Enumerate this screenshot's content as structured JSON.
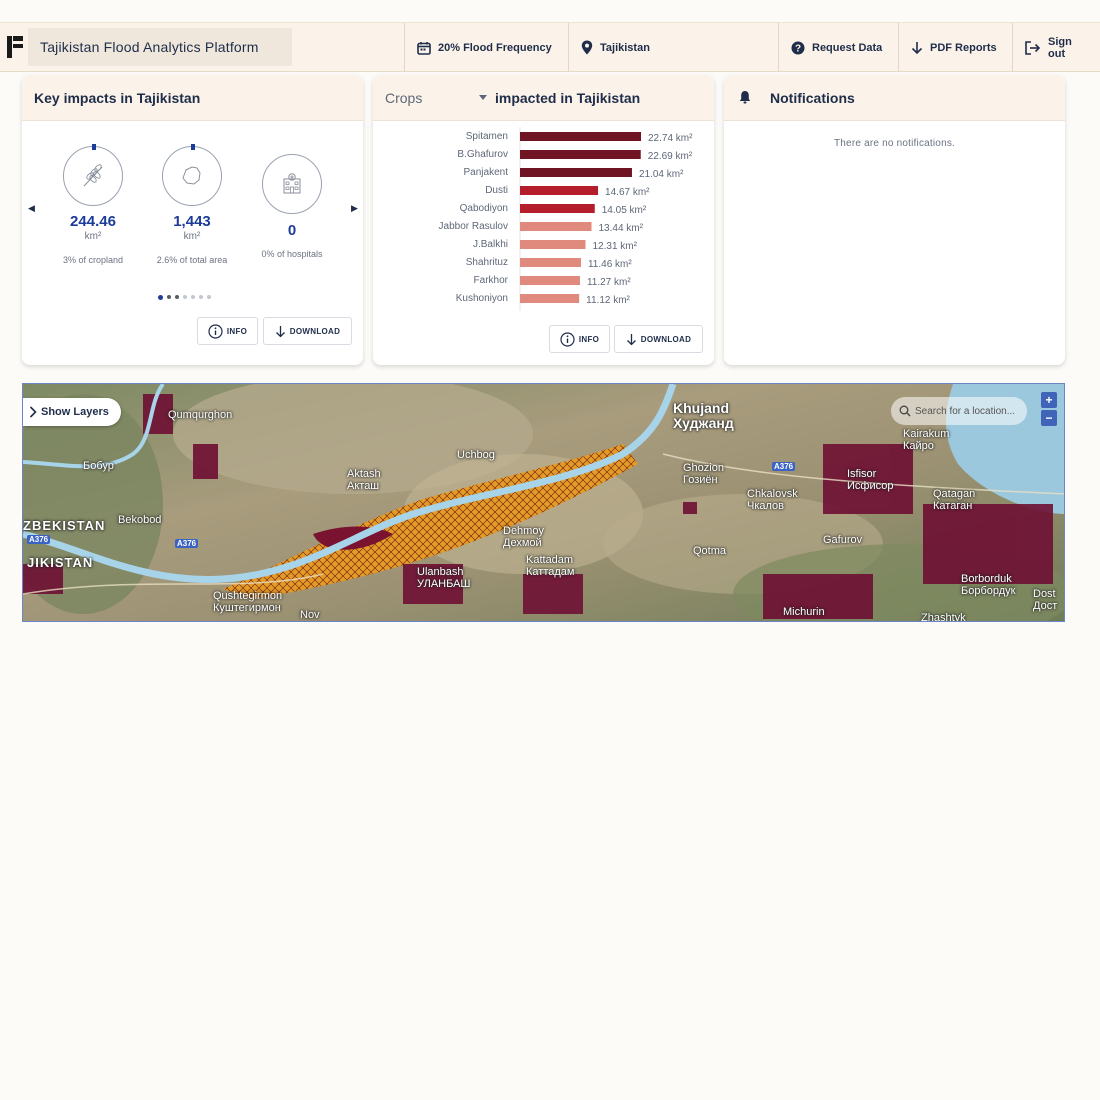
{
  "header": {
    "app_title": "Tajikistan Flood Analytics Platform",
    "nav": [
      {
        "label": "20% Flood Frequency",
        "icon": "calendar-icon"
      },
      {
        "label": "Tajikistan",
        "icon": "map-pin-icon"
      },
      {
        "label": "Request Data",
        "icon": "question-icon"
      },
      {
        "label": "PDF Reports",
        "icon": "download-arrow-icon"
      },
      {
        "label": "Sign out",
        "icon": "sign-out-icon"
      }
    ]
  },
  "impacts_card": {
    "title": "Key impacts in Tajikistan",
    "stats": [
      {
        "value": "244.46",
        "unit": "km²",
        "description": "3% of cropland",
        "icon": "wheat-icon"
      },
      {
        "value": "1,443",
        "unit": "km²",
        "description": "2.6% of total area",
        "icon": "area-outline-icon"
      },
      {
        "value": "0",
        "unit": "",
        "description": "0% of hospitals",
        "icon": "hospital-icon"
      }
    ],
    "info_label": "INFO",
    "download_label": "DOWNLOAD",
    "active_page": 1,
    "page_count": 7
  },
  "crops_card": {
    "dropdown_value": "Crops",
    "title_suffix": "impacted in Tajikistan",
    "info_label": "INFO",
    "download_label": "DOWNLOAD"
  },
  "chart_data": {
    "type": "bar",
    "orientation": "horizontal",
    "categories": [
      "Spitamen",
      "B.Ghafurov",
      "Panjakent",
      "Dusti",
      "Qabodiyon",
      "Jabbor Rasulov",
      "J.Balkhi",
      "Shahrituz",
      "Farkhor",
      "Kushoniyon"
    ],
    "values": [
      22.74,
      22.69,
      21.04,
      14.67,
      14.05,
      13.44,
      12.31,
      11.46,
      11.27,
      11.12
    ],
    "labels": [
      "22.74 km²",
      "22.69 km²",
      "21.04 km²",
      "14.67 km²",
      "14.05 km²",
      "13.44 km²",
      "12.31 km²",
      "11.46 km²",
      "11.27 km²",
      "11.12 km²"
    ],
    "unit": "km²",
    "colors": [
      "#6e1423",
      "#6e1423",
      "#6e1423",
      "#b41e2c",
      "#b41e2c",
      "#e08a7d",
      "#e08a7d",
      "#e08a7d",
      "#e08a7d",
      "#e08a7d"
    ],
    "title": "",
    "xlabel": "",
    "ylabel": ""
  },
  "notifications_card": {
    "title": "Notifications",
    "empty_text": "There are no notifications."
  },
  "map": {
    "show_layers_label": "Show Layers",
    "search_placeholder": "Search for a location...",
    "zoom_in": "+",
    "zoom_out": "−",
    "labels": [
      {
        "text": "Khujand",
        "sub": "Худжанд",
        "kind": "big"
      },
      {
        "text": "Ghozion",
        "sub": "Гозиён"
      },
      {
        "text": "Chkalovsk",
        "sub": "Чкалов"
      },
      {
        "text": "Isfisor",
        "sub": "Исфисор"
      },
      {
        "text": "Kairakum",
        "sub": "Кайро"
      },
      {
        "text": "Qatagan",
        "sub": "Катаган"
      },
      {
        "text": "Gafurov",
        "sub": ""
      },
      {
        "text": "Borborduk",
        "sub": "Борбордук"
      },
      {
        "text": "Dost",
        "sub": "Дост"
      },
      {
        "text": "Michurin",
        "sub": ""
      },
      {
        "text": "Zhashtyk",
        "sub": ""
      },
      {
        "text": "Qotma",
        "sub": ""
      },
      {
        "text": "Kattadam",
        "sub": "Каттадам"
      },
      {
        "text": "Dehmoy",
        "sub": "Дехмой"
      },
      {
        "text": "Ulanbash",
        "sub": "УЛАНБАШ"
      },
      {
        "text": "Qushtegirmon",
        "sub": "Куштегирмон"
      },
      {
        "text": "Aktash",
        "sub": "Акташ"
      },
      {
        "text": "Uchbog",
        "sub": ""
      },
      {
        "text": "Bekobod",
        "sub": ""
      },
      {
        "text": "Бобур",
        "sub": ""
      },
      {
        "text": "Qumqurghon",
        "sub": ""
      },
      {
        "text": "ZBEKISTAN",
        "sub": "",
        "kind": "country"
      },
      {
        "text": "JIKISTAN",
        "sub": "",
        "kind": "country"
      },
      {
        "text": "Nov",
        "sub": ""
      }
    ],
    "road_shields": [
      "A376",
      "A376",
      "A376"
    ]
  }
}
